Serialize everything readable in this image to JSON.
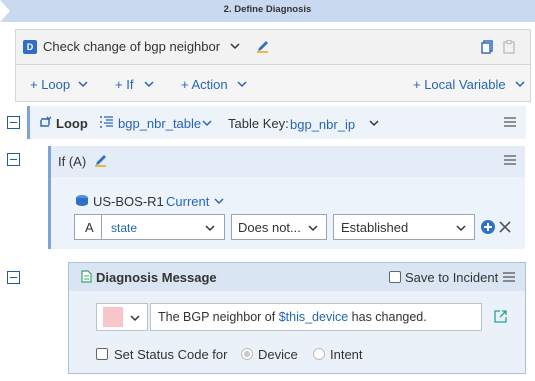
{
  "banner": {
    "title": "2. Define Diagnosis"
  },
  "header": {
    "badge": "D",
    "title": "Check change of bgp neighbor"
  },
  "toolbar": {
    "loop_label": "+ Loop",
    "if_label": "+ If",
    "action_label": "+ Action",
    "local_variable_label": "+ Local Variable"
  },
  "loop": {
    "label": "Loop",
    "table": "bgp_nbr_table",
    "table_key_label": "Table Key:",
    "table_key_value": "bgp_nbr_ip"
  },
  "if_block": {
    "label": "If (A)",
    "device": "US-BOS-R1",
    "device_state": "Current",
    "condition": {
      "alias": "A",
      "field": "state",
      "operator": "Does not...",
      "value": "Established"
    }
  },
  "diagnosis_message": {
    "title": "Diagnosis Message",
    "save_to_incident_label": "Save to Incident",
    "message_prefix": "The BGP neighbor of ",
    "message_variable": "$this_device",
    "message_suffix": " has changed.",
    "swatch_color": "#f7c6cb",
    "set_status_label": "Set Status Code for",
    "radio_device": "Device",
    "radio_intent": "Intent"
  },
  "colors": {
    "accent": "#2565b8",
    "banner": "#c9d9f0",
    "plus_circle": "#2f6fc4"
  }
}
